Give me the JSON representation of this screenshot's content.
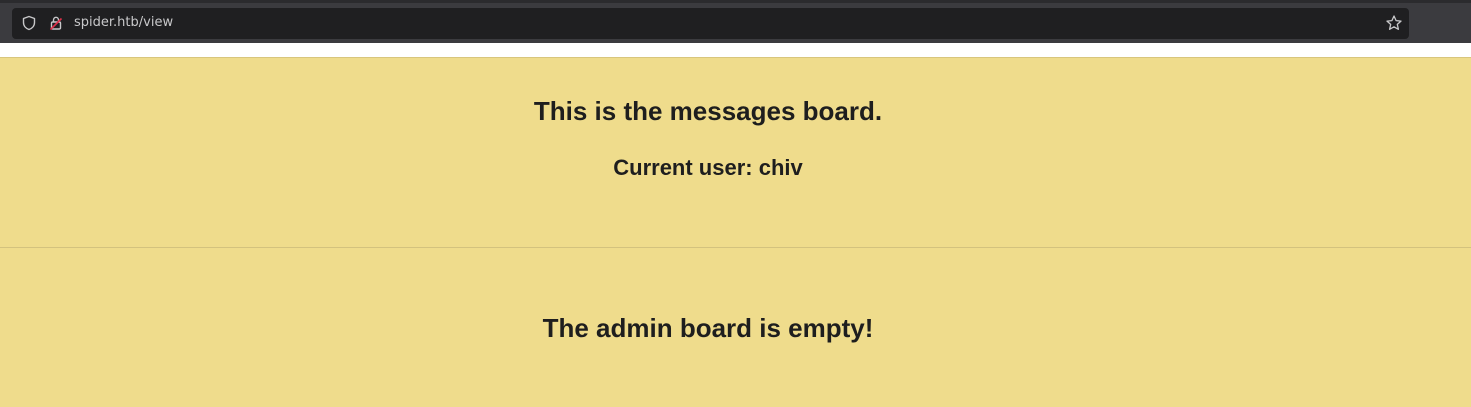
{
  "browser": {
    "url": "spider.htb/view",
    "icons": {
      "shield": "shield-icon",
      "lock": "lock-insecure-icon",
      "star": "star-icon"
    }
  },
  "page": {
    "title": "This is the messages board.",
    "current_user": "Current user: chiv",
    "admin_message": "The admin board is empty!",
    "colors": {
      "background": "#efdc8c",
      "text": "#1e1e1e"
    }
  }
}
